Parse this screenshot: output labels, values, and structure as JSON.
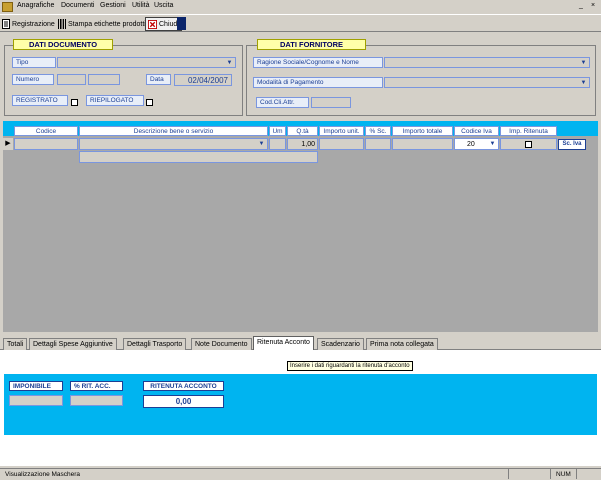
{
  "menu": {
    "items": [
      "Anagrafiche",
      "Documenti",
      "Gestioni",
      "Utilità",
      "Uscita"
    ],
    "window_buttons": [
      "_",
      "×"
    ]
  },
  "toolbar": {
    "registrazione": "Registrazione",
    "stampa": "Stampa etichette prodotti",
    "chiudi": "Chiudi"
  },
  "dati_documento": {
    "title": "DATI DOCUMENTO",
    "tipo_label": "Tipo",
    "numero_label": "Numero",
    "data_label": "Data",
    "data_value": "02/04/2007",
    "registrato_label": "REGISTRATO",
    "riepilogato_label": "RIEPILOGATO"
  },
  "dati_fornitore": {
    "title": "DATI FORNITORE",
    "ragione_label": "Ragione Sociale/Cognome e Nome",
    "modalita_label": "Modalità di Pagamento",
    "codcli_label": "Cod.Cli.Attr."
  },
  "grid": {
    "headers": [
      "Codice",
      "Descrizione bene o servizio",
      "Um",
      "Q.tà",
      "Importo unit.",
      "% Sc.",
      "Importo totale",
      "Codice Iva",
      "Imp. Ritenuta"
    ],
    "row": {
      "quantita": "1,00",
      "codice_iva": "20"
    },
    "sc_iva_button": "Sc. Iva"
  },
  "tabs": [
    "Totali",
    "Dettagli Spese Aggiuntive",
    "Dettagli Trasporto",
    "Note Documento",
    "Ritenuta Acconto",
    "Scadenzario",
    "Prima nota collegata"
  ],
  "active_tab": "Ritenuta Acconto",
  "tooltip": "Inserire i dati riguardanti la ritenuta d'acconto",
  "ritenuta": {
    "imponibile_label": "IMPONIBILE",
    "perc_label": "% RIT. ACC.",
    "ritenuta_label": "RITENUTA ACCONTO",
    "ritenuta_value": "0,00"
  },
  "status": {
    "left": "Visualizzazione Maschera",
    "num": "NUM"
  },
  "colors": {
    "accent_blue": "#00b4f0",
    "label_text": "#1c3f94",
    "title_yellow": "#ffffa8"
  }
}
